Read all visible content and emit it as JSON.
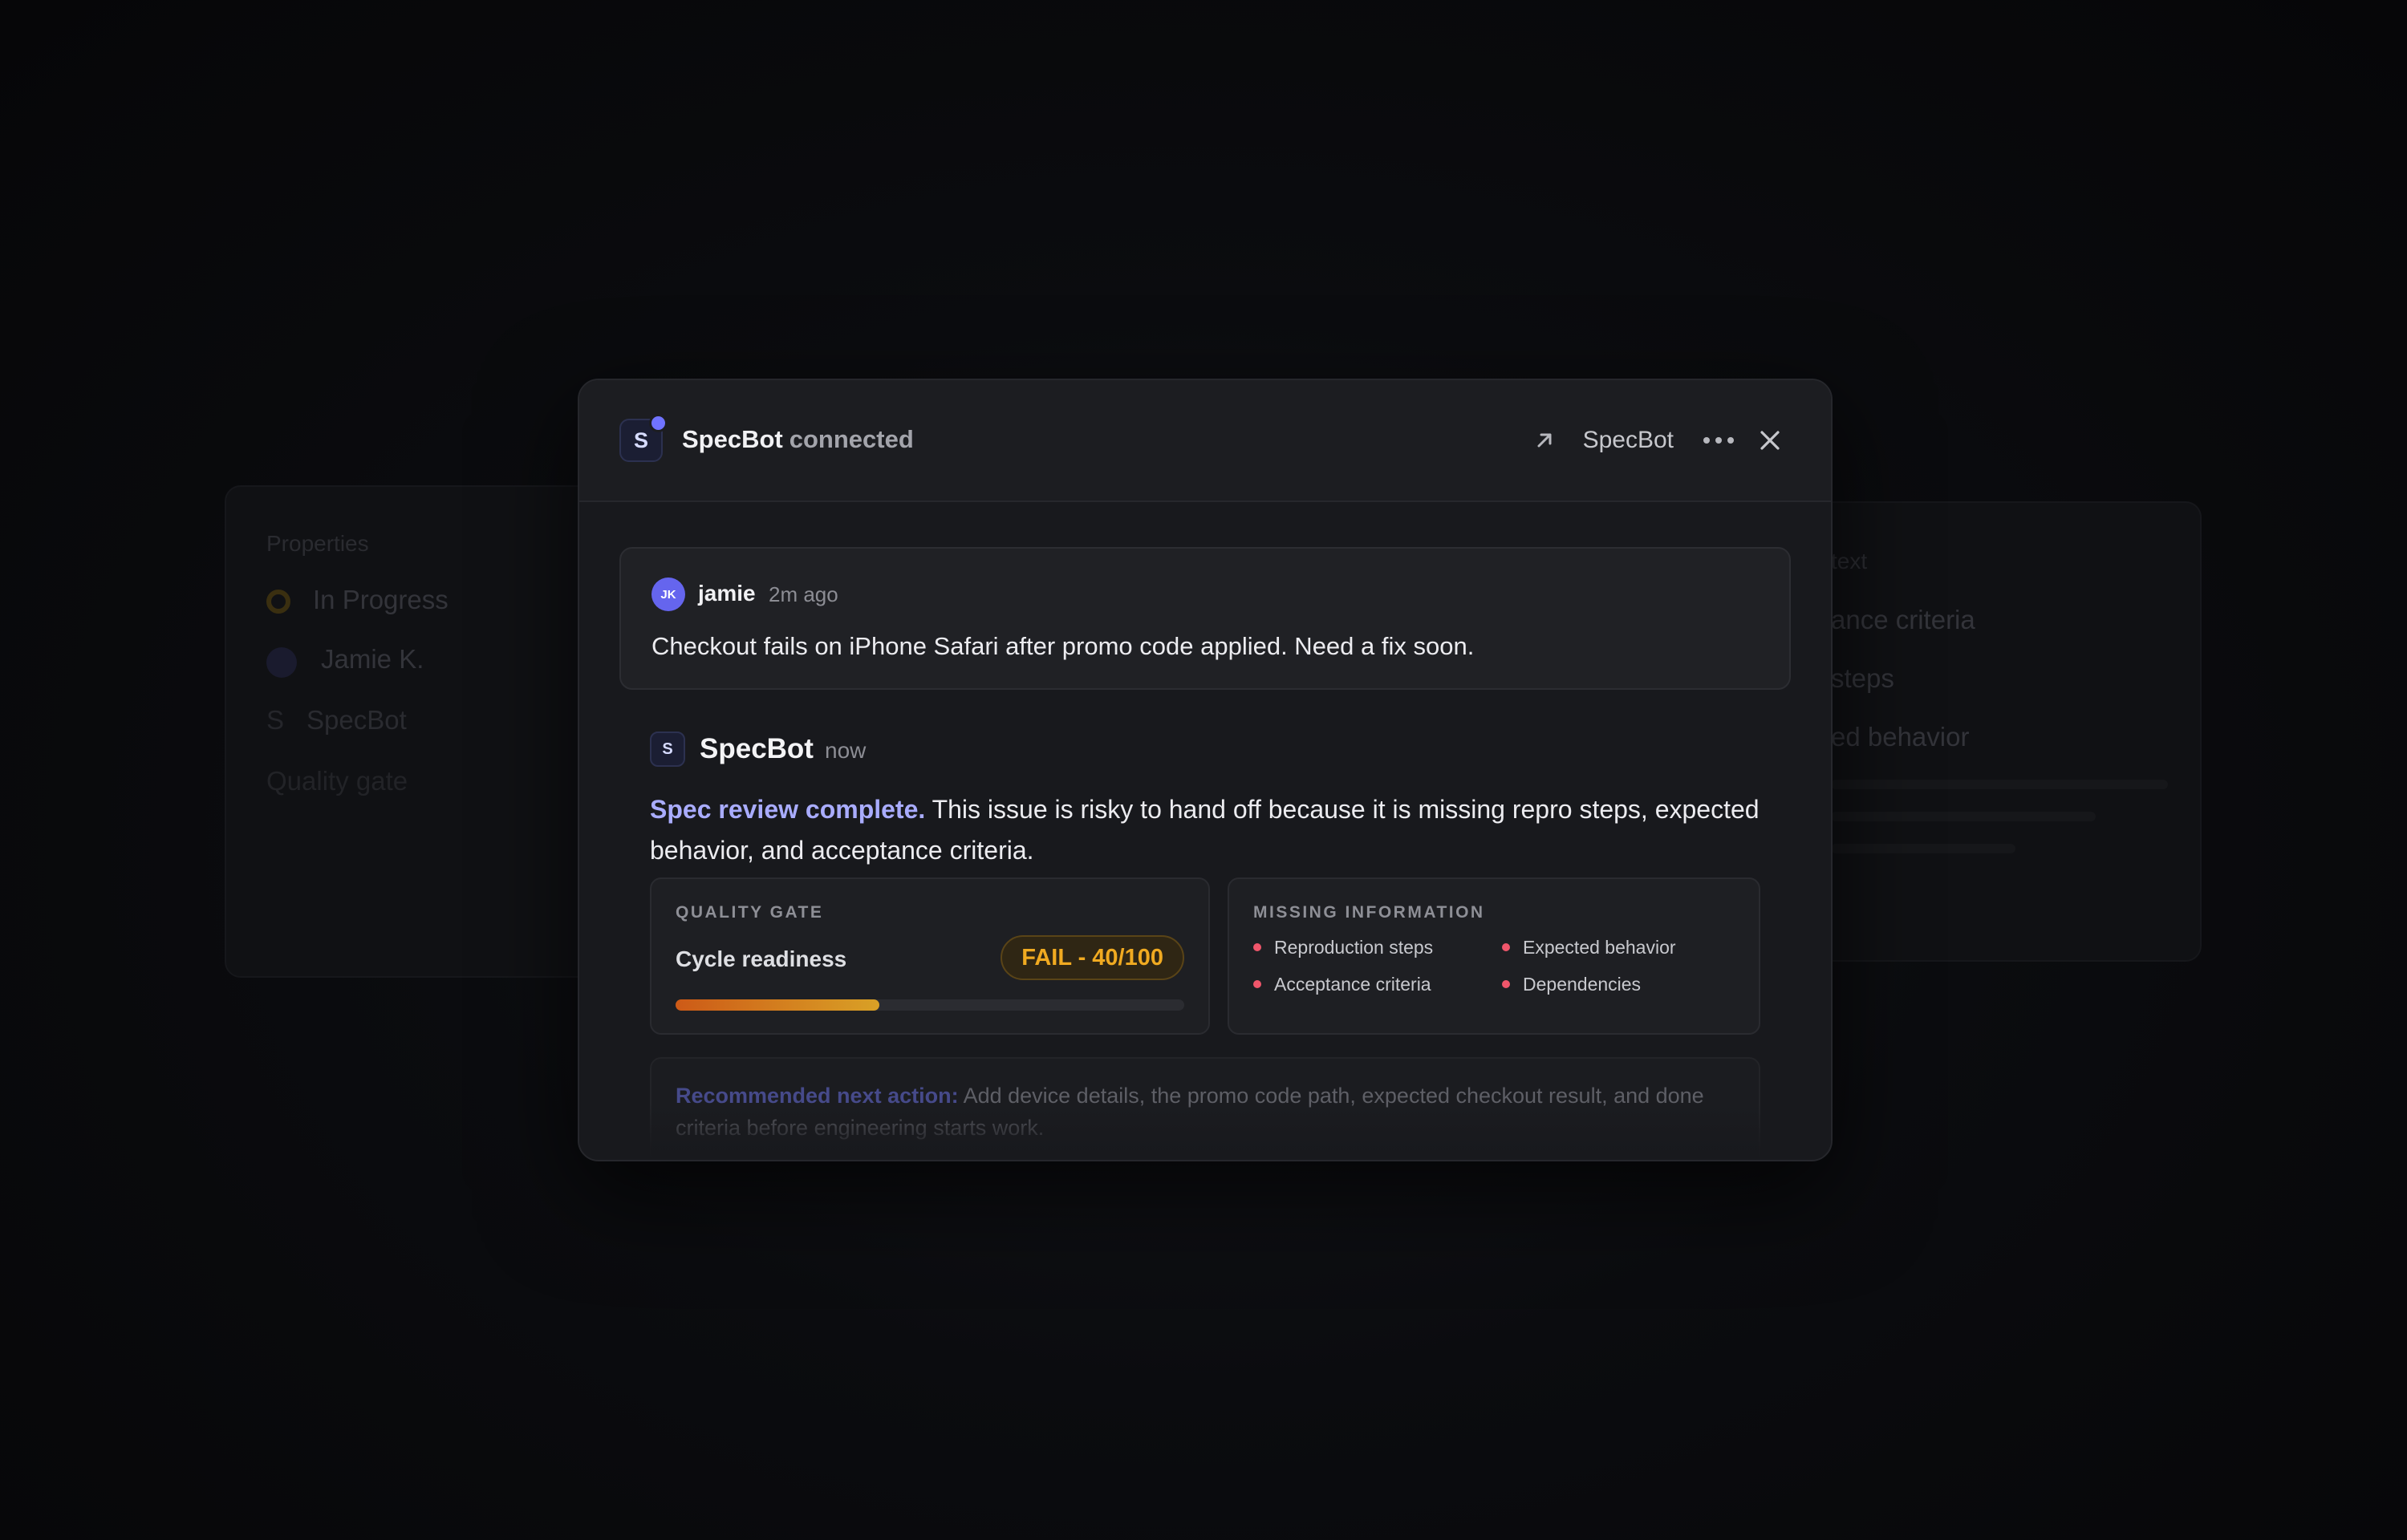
{
  "background": {
    "left_panel": {
      "heading": "Properties",
      "items": [
        {
          "label": "In Progress",
          "icon": "status-circle-icon"
        },
        {
          "label": "Jamie K.",
          "icon": "avatar"
        },
        {
          "label": "SpecBot",
          "icon": "specbot-logo"
        },
        {
          "label": "Quality gate",
          "icon": ""
        }
      ]
    },
    "right_panel": {
      "heading": "text",
      "items": [
        "ance criteria",
        "steps",
        "ed behavior"
      ]
    }
  },
  "modal": {
    "header": {
      "logo_letter": "S",
      "title_bold": "SpecBot",
      "title_muted": "connected",
      "bot_name": "SpecBot",
      "icons": [
        "open-external-icon",
        "more-icon",
        "close-icon"
      ]
    },
    "user_message": {
      "avatar_initials": "JK",
      "author": "jamie",
      "time": "2m ago",
      "text": "Checkout fails on iPhone Safari after promo code applied. Need a fix soon."
    },
    "bot_message": {
      "logo_letter": "S",
      "author": "SpecBot",
      "time": "now",
      "highlight": "Spec review complete.",
      "text": " This issue is risky to hand off because it is missing repro steps, expected behavior, and acceptance criteria."
    },
    "quality_gate": {
      "label": "QUALITY GATE",
      "row_label": "Cycle readiness",
      "badge": "FAIL - 40/100",
      "score": 40,
      "max": 100
    },
    "missing_info": {
      "label": "MISSING INFORMATION",
      "items": [
        "Reproduction steps",
        "Expected behavior",
        "Acceptance criteria",
        "Dependencies"
      ]
    },
    "next_action": {
      "lead": "Recommended next action:",
      "text": " Add device details, the promo code path, expected checkout result, and done criteria before engineering starts work."
    }
  },
  "colors": {
    "accent": "#a9acff",
    "fail": "#f0aa21",
    "missing_dot": "#f0566b",
    "avatar": "#6565ee"
  }
}
